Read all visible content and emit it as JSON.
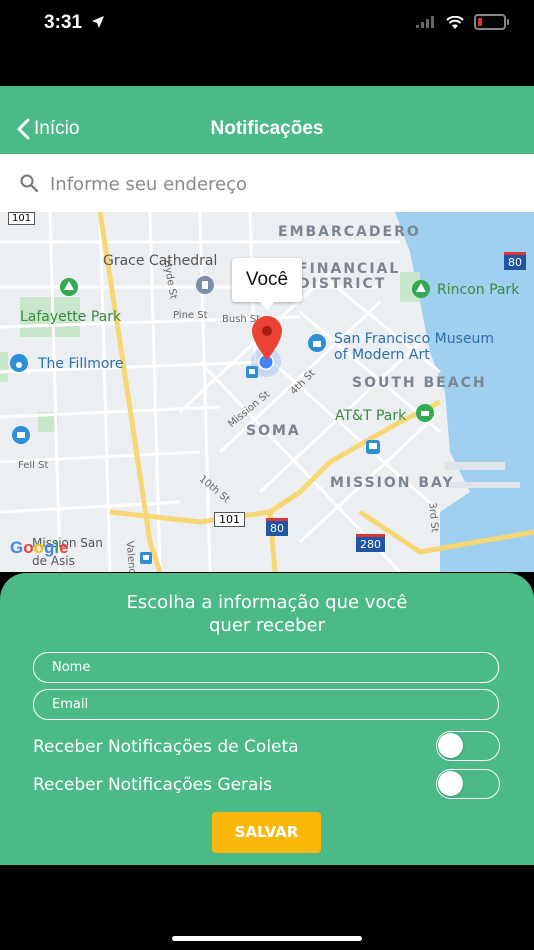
{
  "status_bar": {
    "time": "3:31",
    "battery_color": "#e2352d"
  },
  "nav": {
    "back_label": "Início",
    "title": "Notificações",
    "bg_color": "#4cba87"
  },
  "search": {
    "placeholder": "Informe seu endereço",
    "icon": "search-icon"
  },
  "map": {
    "callout": "Você",
    "labels": {
      "embarcadero": "EMBARCADERO",
      "grace": "Grace Cathedral",
      "financial1": "FINANCIAL",
      "financial2": "DISTRICT",
      "rincon": "Rincon Park",
      "lafayette": "Lafayette Park",
      "sfmoma1": "San Francisco Museum",
      "sfmoma2": "of Modern Art",
      "fillmore": "The Fillmore",
      "south_beach": "SOUTH BEACH",
      "att_park": "AT&T Park",
      "soma": "SOMA",
      "mission_bay": "MISSION BAY",
      "pine": "Pine St",
      "bush": "Bush St",
      "hyde": "Hyde St",
      "fourth": "4th St",
      "mission": "Mission St",
      "fell": "Fell St",
      "tenth": "10th St",
      "third": "3rd St",
      "valencia": "Valenc",
      "mission_dolores1": "Mission San",
      "mission_dolores2": "de Asis",
      "hwy101a": "101",
      "hwy101b": "101",
      "i80a": "80",
      "i80b": "80",
      "i280": "280",
      "google": "Google"
    }
  },
  "form": {
    "heading_line1": "Escolha a informação que você",
    "heading_line2": "quer receber",
    "name_placeholder": "Nome",
    "email_placeholder": "Email",
    "toggle_coleta_label": "Receber Notificações de Coleta",
    "toggle_gerais_label": "Receber Notificações Gerais",
    "toggle_coleta_on": false,
    "toggle_gerais_on": false,
    "save_label": "SALVAR",
    "save_color": "#fbb80b"
  }
}
